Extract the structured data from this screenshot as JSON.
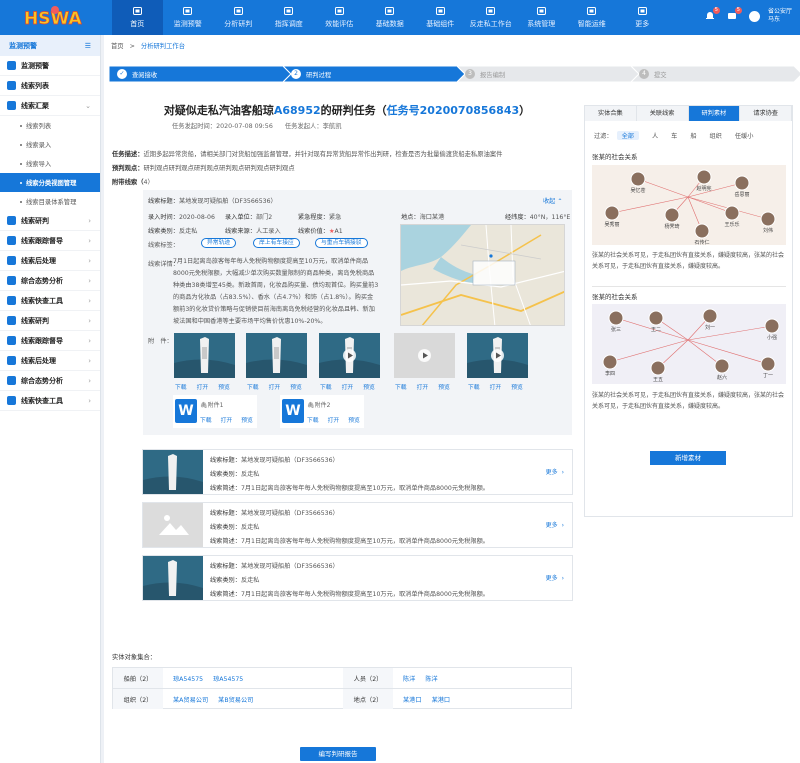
{
  "header": {
    "logo_text": "HSWA",
    "nav": [
      {
        "label": "首页",
        "icon": "home-icon",
        "active": true
      },
      {
        "label": "监测预警",
        "icon": "monitor-icon"
      },
      {
        "label": "分析研判",
        "icon": "analysis-icon"
      },
      {
        "label": "指挥调度",
        "icon": "dispatch-icon"
      },
      {
        "label": "效能评估",
        "icon": "evaluation-icon"
      },
      {
        "label": "基础数据",
        "icon": "chart-icon"
      },
      {
        "label": "基础组件",
        "icon": "component-icon"
      },
      {
        "label": "反走私工作台",
        "icon": "workbench-icon"
      },
      {
        "label": "系统管理",
        "icon": "settings-icon"
      },
      {
        "label": "智能运维",
        "icon": "ops-icon"
      },
      {
        "label": "更多",
        "icon": "more-icon"
      }
    ],
    "badge1": "5",
    "badge2": "5",
    "user_org": "省公安厅",
    "user_name": "马东"
  },
  "sidebar": {
    "title": "监测预警",
    "groups": [
      {
        "label": "监测预警"
      },
      {
        "label": "线索列表"
      },
      {
        "label": "线索汇聚",
        "expanded": true
      },
      {
        "label": "线索研判"
      },
      {
        "label": "线索跟踪督导"
      },
      {
        "label": "线索后处理"
      },
      {
        "label": "综合态势分析"
      },
      {
        "label": "线索快查工具"
      },
      {
        "label": "线索研判"
      },
      {
        "label": "线索跟踪督导"
      },
      {
        "label": "线索后处理"
      },
      {
        "label": "综合态势分析"
      },
      {
        "label": "线索快查工具"
      }
    ],
    "subitems": [
      {
        "label": "线索列表"
      },
      {
        "label": "线索录入"
      },
      {
        "label": "线索导入"
      },
      {
        "label": "线索分类视图管理",
        "active": true
      },
      {
        "label": "线索目录体系管理"
      }
    ]
  },
  "breadcrumb": {
    "home": "首页",
    "sep": ">",
    "current": "分析研判工作台"
  },
  "steps": [
    {
      "num": "✓",
      "label": "查阅接收",
      "state": "done"
    },
    {
      "num": "2",
      "label": "研判过程",
      "state": "current"
    },
    {
      "num": "3",
      "label": "报告编制",
      "state": "todo"
    },
    {
      "num": "4",
      "label": "提交",
      "state": "todo"
    }
  ],
  "task": {
    "title_pre": "对疑似走私汽油客船琼",
    "title_ship": "A68952",
    "title_mid": "的研判任务（",
    "title_task": "任务号2020070856843",
    "title_end": "）",
    "meta_time_label": "任务发起时间：",
    "meta_time": "2020-07-08  09:56",
    "meta_person_label": "任务发起人：",
    "meta_person": "李航凯",
    "desc_label": "任务描述：",
    "desc": "近期多起异常货船，请相关部门对货船加强监督管理，并针对现有异常货船异常作出判研，检查是否为批量偷渡货船走私原油案件",
    "opinion_label": "预判观点：",
    "opinion": "研判观点研判观点研判观点研判观点研判观点研判观点",
    "attached_label": "附带线索（",
    "attached_count": "4",
    "attached_end": "）"
  },
  "clue": {
    "title_label": "线索标题：",
    "title": "某地发现可疑船舶（DF3566536）",
    "collapse": "收起",
    "entry_time_label": "录入时间：",
    "entry_time": "2020-08-06",
    "entry_unit_label": "录入单位：",
    "entry_unit": "部门2",
    "urgency_label": "紧急程度：",
    "urgency": "紧急",
    "location_label": "地点：",
    "location": "海口某港",
    "coord_label": "经纬度：",
    "coord": "40°N，116°E",
    "category_label": "线索类别：",
    "category": "反走私",
    "source_label": "线索来源：",
    "source": "人工录入",
    "value_label": "线索价值：",
    "value": "A1",
    "tags_label": "线索标签：",
    "tags": [
      "异常轨迹",
      "岸上有车接应",
      "与重点车辆接驳"
    ],
    "detail_label": "线索详情：",
    "detail": "7月1日起离岛旅客每年每人免税购物额度提高至10万元，取消单件商品8000元免税限额，大幅减少单次购买数量限制的商品种类，离岛免税商品种类由38类增至45类。新政首周，化妆品购买量、债均现首位。购买量前3的商品为化妆品（占83.5%）、香水（占4.7％）和饰（占1.8％）。购买金额前3的化妆贷价策略与促销使目前海南离岛免税经营的化妆品且韩、新加坡法国和中国香港等主要市场平均售价优惠10%-20%。",
    "attach_label": "附　件：",
    "media": [
      {
        "type": "image",
        "links": [
          "下载",
          "打开",
          "预览"
        ]
      },
      {
        "type": "image",
        "links": [
          "下载",
          "打开",
          "预览"
        ]
      },
      {
        "type": "video",
        "links": [
          "下载",
          "打开",
          "预览"
        ]
      },
      {
        "type": "blank",
        "links": [
          "下载",
          "打开",
          "预览"
        ]
      },
      {
        "type": "video",
        "links": [
          "下载",
          "打开",
          "预览"
        ]
      }
    ],
    "docs": [
      {
        "name": "附件1",
        "links": [
          "下载",
          "打开",
          "预览"
        ]
      },
      {
        "name": "附件2",
        "links": [
          "下载",
          "打开",
          "预览"
        ]
      }
    ]
  },
  "cards": [
    {
      "title_label": "线索标题：",
      "title": "某地发现可疑船舶（DF3566536）",
      "cat_label": "线索类别：",
      "cat": "反走私",
      "sum_label": "线索简述：",
      "sum": "7月1日起离岛旅客每年每人免税购物额度提高至10万元，取消单件商品8000元免税限额。",
      "more": "更多",
      "img": "image"
    },
    {
      "title_label": "线索标题：",
      "title": "某地发现可疑船舶（DF3566536）",
      "cat_label": "线索类别：",
      "cat": "反走私",
      "sum_label": "线索简述：",
      "sum": "7月1日起离岛旅客每年每人免税购物额度提高至10万元，取消单件商品8000元免税限额。",
      "more": "更多",
      "img": "blank"
    },
    {
      "title_label": "线索标题：",
      "title": "某地发现可疑船舶（DF3566536）",
      "cat_label": "线索类别：",
      "cat": "反走私",
      "sum_label": "线索简述：",
      "sum": "7月1日起离岛旅客每年每人免税购物额度提高至10万元，取消单件商品8000元免税限额。",
      "more": "更多",
      "img": "image"
    }
  ],
  "entities": {
    "label": "实体对象集合：",
    "rows": [
      {
        "h1": "船舶（2）",
        "v1": [
          "琼A54575",
          "琼A54575"
        ],
        "h2": "人员（2）",
        "v2": [
          "陈洋",
          "陈洋"
        ]
      },
      {
        "h1": "组织（2）",
        "v1": [
          "某A贸易公司",
          "某B贸易公司"
        ],
        "h2": "地点（2）",
        "v2": [
          "某港口",
          "某港口"
        ]
      }
    ]
  },
  "write_button": "编写判研报告",
  "right_panel": {
    "tabs": [
      {
        "label": "实体合集"
      },
      {
        "label": "关联线索"
      },
      {
        "label": "研判素材",
        "active": true
      },
      {
        "label": "请求协查"
      }
    ],
    "filter_label": "过滤：",
    "filters": [
      {
        "label": "全部",
        "active": true
      },
      {
        "label": "人"
      },
      {
        "label": "车"
      },
      {
        "label": "船"
      },
      {
        "label": "组织"
      },
      {
        "label": "任缓小"
      }
    ],
    "sec1_title": "张某的社会关系",
    "sec1_desc": "张某的社会关系可见，于走私团伙有直接关系，嫌疑度较高，张某的社会关系可见，于走私团伙有直接关系，嫌疑度较高。",
    "sec2_title": "张某的社会关系",
    "sec2_desc": "张某的社会关系可见，于走私团伙有直接关系，嫌疑度较高，张某的社会关系可见，于走私团伙有直接关系，嫌疑度较高。",
    "graph1_names": [
      "吴忆苍",
      "赵明宪",
      "岳思丽",
      "吴秀丽",
      "杨霁琦",
      "王乐乐",
      "刘伟",
      "石传仁"
    ],
    "graph2_names": [
      "张三",
      "王二",
      "刘一",
      "小强",
      "李四",
      "王五",
      "赵六",
      "丁一"
    ],
    "add_button": "新增素材"
  },
  "colors": {
    "primary": "#1677d9",
    "nav_active": "#0f5cb8",
    "badge": "#f25c5c"
  }
}
